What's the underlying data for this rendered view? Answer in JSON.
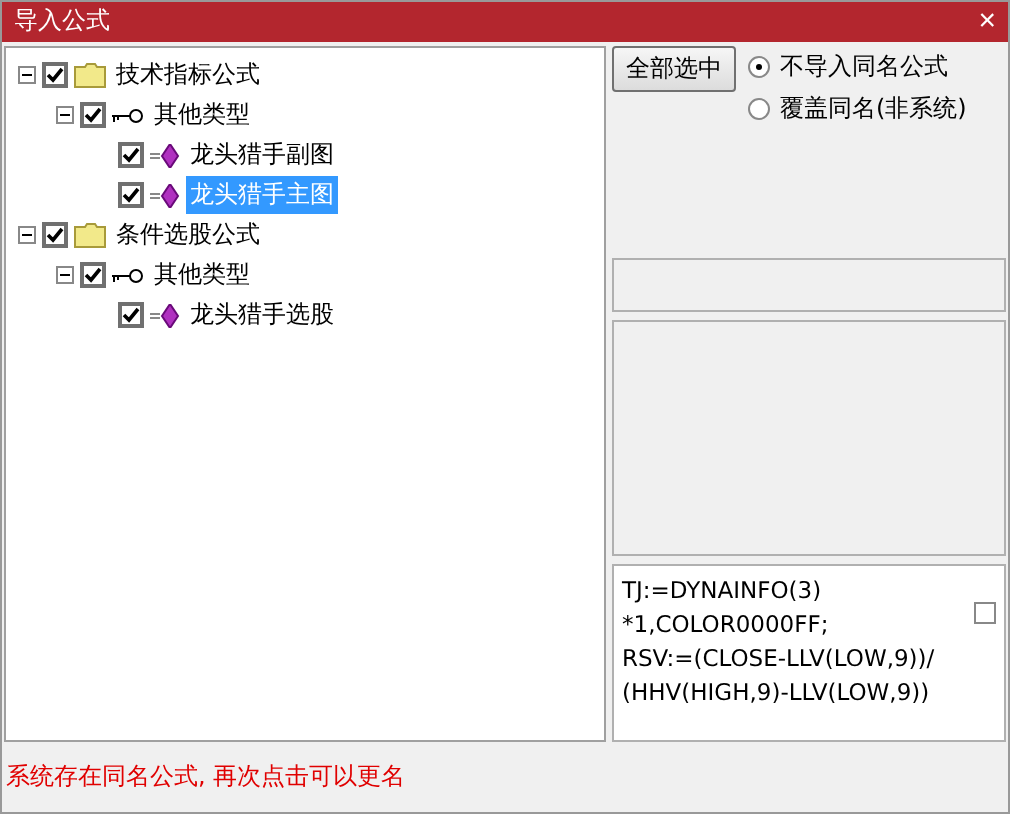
{
  "window": {
    "title": "导入公式",
    "close": "×"
  },
  "tree": [
    {
      "kind": "folder",
      "label": "技术指标公式",
      "checked": true,
      "expanded": true,
      "selected": false,
      "children": [
        {
          "kind": "type",
          "label": "其他类型",
          "checked": true,
          "expanded": true,
          "selected": false,
          "children": [
            {
              "kind": "formula",
              "label": "龙头猎手副图",
              "checked": true,
              "selected": false
            },
            {
              "kind": "formula",
              "label": "龙头猎手主图",
              "checked": true,
              "selected": true
            }
          ]
        }
      ]
    },
    {
      "kind": "folder",
      "label": "条件选股公式",
      "checked": true,
      "expanded": true,
      "selected": false,
      "children": [
        {
          "kind": "type",
          "label": "其他类型",
          "checked": true,
          "expanded": true,
          "selected": false,
          "children": [
            {
              "kind": "formula",
              "label": "龙头猎手选股",
              "checked": true,
              "selected": false
            }
          ]
        }
      ]
    }
  ],
  "select_all_button": "全部选中",
  "options": [
    {
      "label": "不导入同名公式",
      "selected": true
    },
    {
      "label": "覆盖同名(非系统)",
      "selected": false
    }
  ],
  "formula_text": {
    "lines": [
      "TJ:=DYNAINFO(3)",
      "*1,COLOR0000FF;",
      "RSV:=(CLOSE-LLV(LOW,9))/",
      "(HHV(HIGH,9)-LLV(LOW,9))"
    ],
    "checked": false
  },
  "status": "系统存在同名公式, 再次点击可以更名"
}
